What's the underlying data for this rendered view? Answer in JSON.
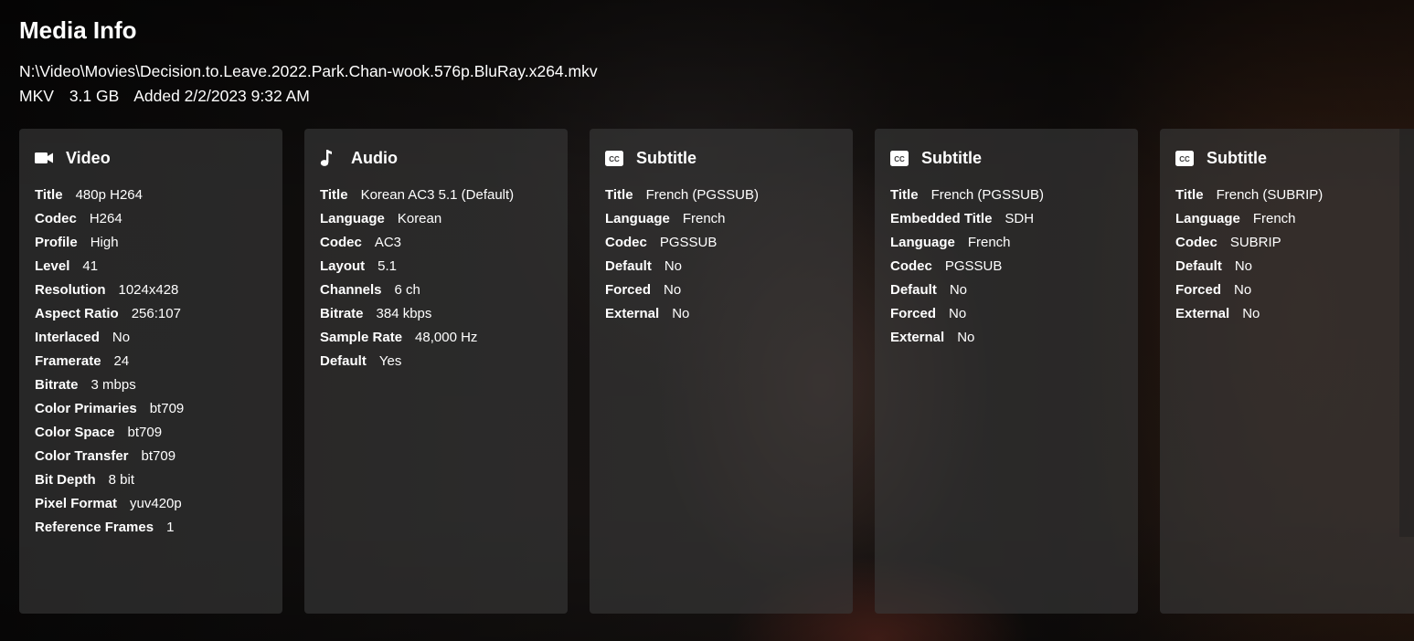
{
  "page": {
    "title": "Media Info",
    "path": "N:\\Video\\Movies\\Decision.to.Leave.2022.Park.Chan-wook.576p.BluRay.x264.mkv",
    "container": "MKV",
    "size": "3.1 GB",
    "added": "Added 2/2/2023 9:32 AM"
  },
  "streams": [
    {
      "type": "Video",
      "icon": "video-camera-icon",
      "rows": [
        {
          "k": "Title",
          "v": "480p H264"
        },
        {
          "k": "Codec",
          "v": "H264"
        },
        {
          "k": "Profile",
          "v": "High"
        },
        {
          "k": "Level",
          "v": "41"
        },
        {
          "k": "Resolution",
          "v": "1024x428"
        },
        {
          "k": "Aspect Ratio",
          "v": "256:107"
        },
        {
          "k": "Interlaced",
          "v": "No"
        },
        {
          "k": "Framerate",
          "v": "24"
        },
        {
          "k": "Bitrate",
          "v": "3 mbps"
        },
        {
          "k": "Color Primaries",
          "v": "bt709"
        },
        {
          "k": "Color Space",
          "v": "bt709"
        },
        {
          "k": "Color Transfer",
          "v": "bt709"
        },
        {
          "k": "Bit Depth",
          "v": "8 bit"
        },
        {
          "k": "Pixel Format",
          "v": "yuv420p"
        },
        {
          "k": "Reference Frames",
          "v": "1"
        }
      ]
    },
    {
      "type": "Audio",
      "icon": "music-note-icon",
      "rows": [
        {
          "k": "Title",
          "v": "Korean AC3 5.1 (Default)"
        },
        {
          "k": "Language",
          "v": "Korean"
        },
        {
          "k": "Codec",
          "v": "AC3"
        },
        {
          "k": "Layout",
          "v": "5.1"
        },
        {
          "k": "Channels",
          "v": "6 ch"
        },
        {
          "k": "Bitrate",
          "v": "384 kbps"
        },
        {
          "k": "Sample Rate",
          "v": "48,000 Hz"
        },
        {
          "k": "Default",
          "v": "Yes"
        }
      ]
    },
    {
      "type": "Subtitle",
      "icon": "closed-caption-icon",
      "rows": [
        {
          "k": "Title",
          "v": "French (PGSSUB)"
        },
        {
          "k": "Language",
          "v": "French"
        },
        {
          "k": "Codec",
          "v": "PGSSUB"
        },
        {
          "k": "Default",
          "v": "No"
        },
        {
          "k": "Forced",
          "v": "No"
        },
        {
          "k": "External",
          "v": "No"
        }
      ]
    },
    {
      "type": "Subtitle",
      "icon": "closed-caption-icon",
      "rows": [
        {
          "k": "Title",
          "v": "French (PGSSUB)"
        },
        {
          "k": "Embedded Title",
          "v": "SDH"
        },
        {
          "k": "Language",
          "v": "French"
        },
        {
          "k": "Codec",
          "v": "PGSSUB"
        },
        {
          "k": "Default",
          "v": "No"
        },
        {
          "k": "Forced",
          "v": "No"
        },
        {
          "k": "External",
          "v": "No"
        }
      ]
    },
    {
      "type": "Subtitle",
      "icon": "closed-caption-icon",
      "rows": [
        {
          "k": "Title",
          "v": "French (SUBRIP)"
        },
        {
          "k": "Language",
          "v": "French"
        },
        {
          "k": "Codec",
          "v": "SUBRIP"
        },
        {
          "k": "Default",
          "v": "No"
        },
        {
          "k": "Forced",
          "v": "No"
        },
        {
          "k": "External",
          "v": "No"
        }
      ]
    }
  ]
}
